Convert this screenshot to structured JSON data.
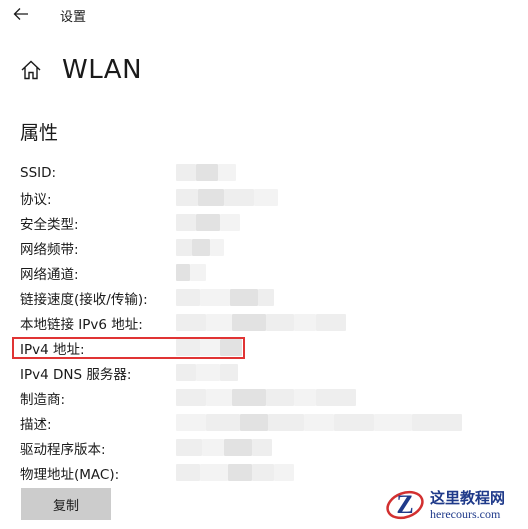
{
  "window": {
    "title": "设置"
  },
  "header": {
    "page_title": "WLAN"
  },
  "section": {
    "title": "属性"
  },
  "properties": [
    {
      "label": "SSID:",
      "blur": [
        [
          20,
          "a"
        ],
        [
          22,
          "b"
        ],
        [
          18,
          "c"
        ]
      ]
    },
    {
      "label": "协议:",
      "blur": [
        [
          22,
          "a"
        ],
        [
          26,
          "b"
        ],
        [
          30,
          "a"
        ],
        [
          24,
          "c"
        ]
      ]
    },
    {
      "label": "安全类型:",
      "blur": [
        [
          20,
          "a"
        ],
        [
          24,
          "b"
        ],
        [
          20,
          "c"
        ]
      ]
    },
    {
      "label": "网络频带:",
      "blur": [
        [
          16,
          "a"
        ],
        [
          18,
          "b"
        ],
        [
          14,
          "c"
        ]
      ]
    },
    {
      "label": "网络通道:",
      "blur": [
        [
          14,
          "b"
        ],
        [
          16,
          "c"
        ]
      ]
    },
    {
      "label": "链接速度(接收/传输):",
      "blur": [
        [
          24,
          "a"
        ],
        [
          30,
          "c"
        ],
        [
          28,
          "b"
        ],
        [
          16,
          "a"
        ]
      ]
    },
    {
      "label": "本地链接 IPv6 地址:",
      "blur": [
        [
          30,
          "a"
        ],
        [
          26,
          "c"
        ],
        [
          34,
          "b"
        ],
        [
          28,
          "a"
        ],
        [
          22,
          "c"
        ],
        [
          30,
          "a"
        ]
      ]
    },
    {
      "label": "IPv4 地址:",
      "blur": [
        [
          24,
          "a"
        ],
        [
          20,
          "c"
        ],
        [
          22,
          "b"
        ]
      ]
    },
    {
      "label": "IPv4 DNS 服务器:",
      "blur": [
        [
          20,
          "a"
        ],
        [
          24,
          "c"
        ],
        [
          18,
          "a"
        ]
      ]
    },
    {
      "label": "制造商:",
      "blur": [
        [
          30,
          "a"
        ],
        [
          26,
          "c"
        ],
        [
          34,
          "b"
        ],
        [
          28,
          "a"
        ],
        [
          22,
          "c"
        ],
        [
          40,
          "a"
        ]
      ]
    },
    {
      "label": "描述:",
      "blur": [
        [
          30,
          "c"
        ],
        [
          34,
          "a"
        ],
        [
          28,
          "b"
        ],
        [
          36,
          "a"
        ],
        [
          30,
          "c"
        ],
        [
          40,
          "a"
        ],
        [
          38,
          "c"
        ],
        [
          50,
          "a"
        ]
      ]
    },
    {
      "label": "驱动程序版本:",
      "blur": [
        [
          26,
          "a"
        ],
        [
          22,
          "c"
        ],
        [
          28,
          "b"
        ],
        [
          20,
          "a"
        ]
      ]
    },
    {
      "label": "物理地址(MAC):",
      "blur": [
        [
          24,
          "a"
        ],
        [
          28,
          "c"
        ],
        [
          24,
          "b"
        ],
        [
          22,
          "a"
        ],
        [
          20,
          "c"
        ]
      ]
    }
  ],
  "copy_button": {
    "label": "复制"
  },
  "watermark": {
    "name": "这里教程网",
    "url": "herecours.com",
    "mark": "Z"
  },
  "colors": {
    "highlight": "#e03434",
    "watermark": "#1f3a8a",
    "button_bg": "#cccccc"
  }
}
